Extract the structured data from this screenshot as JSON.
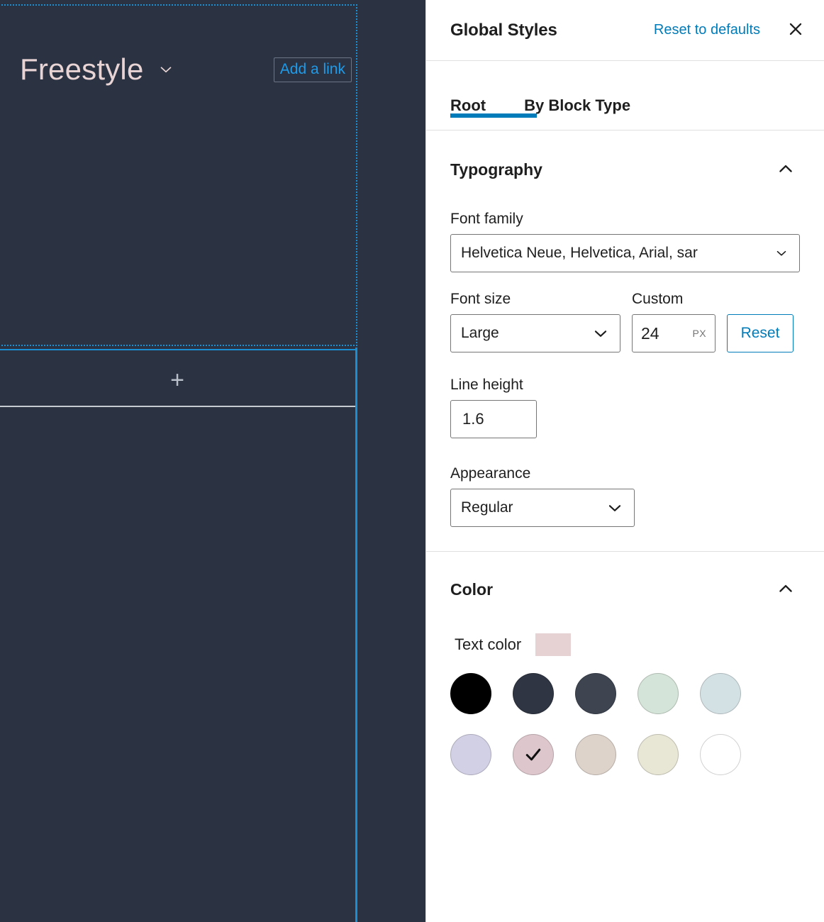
{
  "editor": {
    "site_title": "Freestyle",
    "title_chevron_icon": "chevron-down-icon",
    "add_link_label": "Add a link",
    "appender_icon": "plus-icon",
    "appender_glyph": "+",
    "selection_color": "#1a8fd4",
    "canvas_background": "#2b3242",
    "title_color": "#e8d4d4"
  },
  "sidebar": {
    "header": {
      "title": "Global Styles",
      "reset_label": "Reset to defaults",
      "close_icon": "close-icon",
      "link_color": "#007cba"
    },
    "tabs": [
      {
        "label": "Root",
        "active": true
      },
      {
        "label": "By Block Type",
        "active": false
      }
    ],
    "typography": {
      "title": "Typography",
      "toggle_icon": "chevron-up-icon",
      "font_family": {
        "label": "Font family",
        "value": "Helvetica Neue, Helvetica, Arial, sar",
        "caret_icon": "chevron-down-icon"
      },
      "font_size": {
        "label": "Font size",
        "value": "Large",
        "caret_icon": "chevron-down-icon"
      },
      "custom": {
        "label": "Custom",
        "value": "24",
        "unit": "PX",
        "reset_label": "Reset"
      },
      "line_height": {
        "label": "Line height",
        "value": "1.6"
      },
      "appearance": {
        "label": "Appearance",
        "value": "Regular",
        "caret_icon": "chevron-down-icon"
      }
    },
    "color": {
      "title": "Color",
      "toggle_icon": "chevron-up-icon",
      "text_color": {
        "label": "Text color",
        "current": "#e6d2d2"
      },
      "palette": [
        {
          "hex": "#000000",
          "selected": false
        },
        {
          "hex": "#2f3542",
          "selected": false
        },
        {
          "hex": "#3e4551",
          "selected": false
        },
        {
          "hex": "#d5e4d8",
          "selected": false
        },
        {
          "hex": "#d4e1e4",
          "selected": false
        },
        {
          "hex": "#d2d0e4",
          "selected": false
        },
        {
          "hex": "#ddc7cd",
          "selected": true
        },
        {
          "hex": "#ded3cb",
          "selected": false
        },
        {
          "hex": "#e8e6d5",
          "selected": false
        },
        {
          "hex": "#ffffff",
          "selected": false
        }
      ],
      "check_icon": "check-icon"
    }
  }
}
